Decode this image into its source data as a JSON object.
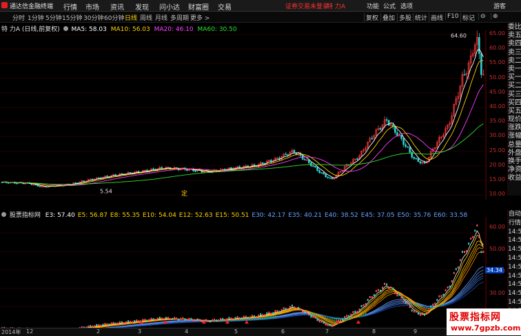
{
  "app": {
    "title": "通达信金融终端",
    "menu": [
      "行情",
      "市场",
      "资讯",
      "发现",
      "问小达",
      "财富圈",
      "交易"
    ],
    "warning": "证券交易未登录",
    "stock_name": "特 力A",
    "right_menu": [
      "功能",
      "公式",
      "选项",
      "游客"
    ]
  },
  "periods": {
    "items": [
      "分时",
      "1分钟",
      "5分钟",
      "15分钟",
      "30分钟",
      "60分钟",
      "日线",
      "周线",
      "月线",
      "多周期",
      "更多 >"
    ],
    "active_index": 6
  },
  "toolbar": [
    "复权",
    "叠加",
    "多股",
    "统计",
    "画线",
    "F10",
    "标记",
    "⊖",
    "⊕"
  ],
  "main_panel": {
    "header": "特 力A (日线,前复权)",
    "indicators": [
      {
        "label": "MA5: 58.03",
        "color": "#ffffff"
      },
      {
        "label": "MA10: 56.03",
        "color": "#ffd200"
      },
      {
        "label": "MA20: 46.10",
        "color": "#ff40ff"
      },
      {
        "label": "MA60: 30.50",
        "color": "#30e030"
      }
    ],
    "high_label": "64.60",
    "low_label": "5.54",
    "marker": "定",
    "y_ticks": [
      "65.00",
      "60.00",
      "55.00",
      "50.00",
      "45.00",
      "40.00",
      "35.00",
      "30.00",
      "25.00",
      "20.00",
      "15.00",
      "10.00"
    ],
    "corner_label": "L"
  },
  "side_panel": {
    "items": [
      "委比",
      "卖五",
      "卖四",
      "卖三",
      "卖二",
      "卖一",
      "买一",
      "买二",
      "买三",
      "买四",
      "买五",
      "现价",
      "涨跌",
      "涨幅",
      "总量",
      "外盘",
      "换手",
      "净资",
      "收益"
    ]
  },
  "sub_panel": {
    "header": "股票指标网",
    "indicators": [
      {
        "label": "E3: 57.40",
        "color": "#ffffff"
      },
      {
        "label": "E5: 56.87",
        "color": "#ffd200"
      },
      {
        "label": "E8: 55.35",
        "color": "#ffd200"
      },
      {
        "label": "E10: 54.04",
        "color": "#ffd200"
      },
      {
        "label": "E12: 52.63",
        "color": "#ffd200"
      },
      {
        "label": "E15: 50.51",
        "color": "#ffd200"
      },
      {
        "label": "E30: 42.17",
        "color": "#6aa0ff"
      },
      {
        "label": "E35: 40.21",
        "color": "#6aa0ff"
      },
      {
        "label": "E40: 38.52",
        "color": "#6aa0ff"
      },
      {
        "label": "E45: 37.05",
        "color": "#6aa0ff"
      },
      {
        "label": "E50: 35.76",
        "color": "#6aa0ff"
      },
      {
        "label": "E60: 33.58",
        "color": "#6aa0ff"
      }
    ],
    "y_ticks": [
      "60.00",
      "50.00",
      "40.00",
      "30.00",
      "20.00"
    ],
    "current": "34.34",
    "side_items": [
      "自动",
      "行情",
      "14:55",
      "14:55",
      "14:55",
      "14:55",
      "14:55",
      "14:55",
      "14:55",
      "14:55",
      "14:55",
      "14:55"
    ]
  },
  "bottom": {
    "start": "2014年",
    "months": [
      "12",
      "2",
      "3",
      "4",
      "5",
      "6",
      "7",
      "8",
      "9",
      "10"
    ]
  },
  "watermark": {
    "line1": "股票指标网",
    "line2": "www.7gpzb.com"
  }
}
